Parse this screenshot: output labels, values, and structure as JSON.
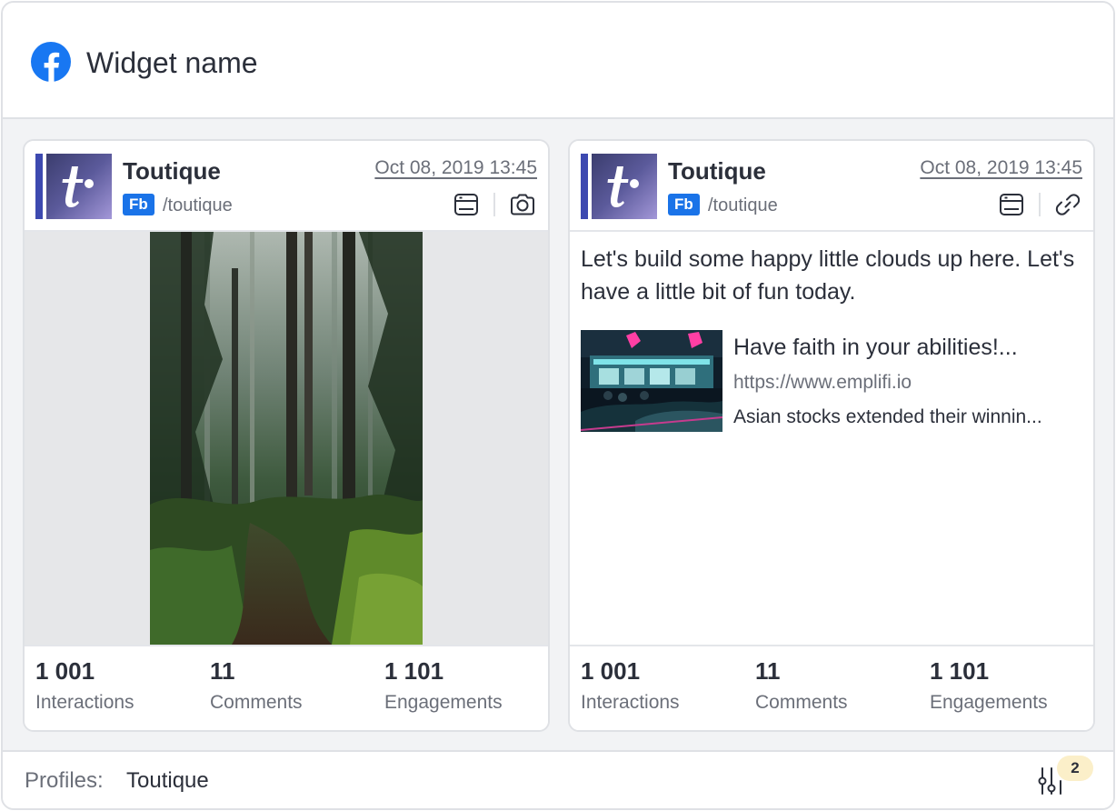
{
  "widget": {
    "title": "Widget name",
    "header_icon": "facebook-icon",
    "accent_color": "#1877f2"
  },
  "posts": [
    {
      "profile_name": "Toutique",
      "network_badge": "Fb",
      "handle": "/toutique",
      "date": "Oct 08, 2019 13:45",
      "type_icon": "camera-icon",
      "media_description_icon": "forest-photo",
      "stats": [
        {
          "value": "1 001",
          "label": "Interactions"
        },
        {
          "value": "11",
          "label": "Comments"
        },
        {
          "value": "1 101",
          "label": "Engagements"
        }
      ]
    },
    {
      "profile_name": "Toutique",
      "network_badge": "Fb",
      "handle": "/toutique",
      "date": "Oct 08, 2019 13:45",
      "type_icon": "link-icon",
      "text": "Let's build some happy little clouds up here. Let's have a little bit of fun today.",
      "link": {
        "title": "Have faith in your abilities!...",
        "url": "https://www.emplifi.io",
        "description": "Asian stocks extended their winnin..."
      },
      "stats": [
        {
          "value": "1 001",
          "label": "Interactions"
        },
        {
          "value": "11",
          "label": "Comments"
        },
        {
          "value": "1 101",
          "label": "Engagements"
        }
      ]
    }
  ],
  "footer": {
    "label": "Profiles:",
    "value": "Toutique",
    "filter_count": "2"
  }
}
